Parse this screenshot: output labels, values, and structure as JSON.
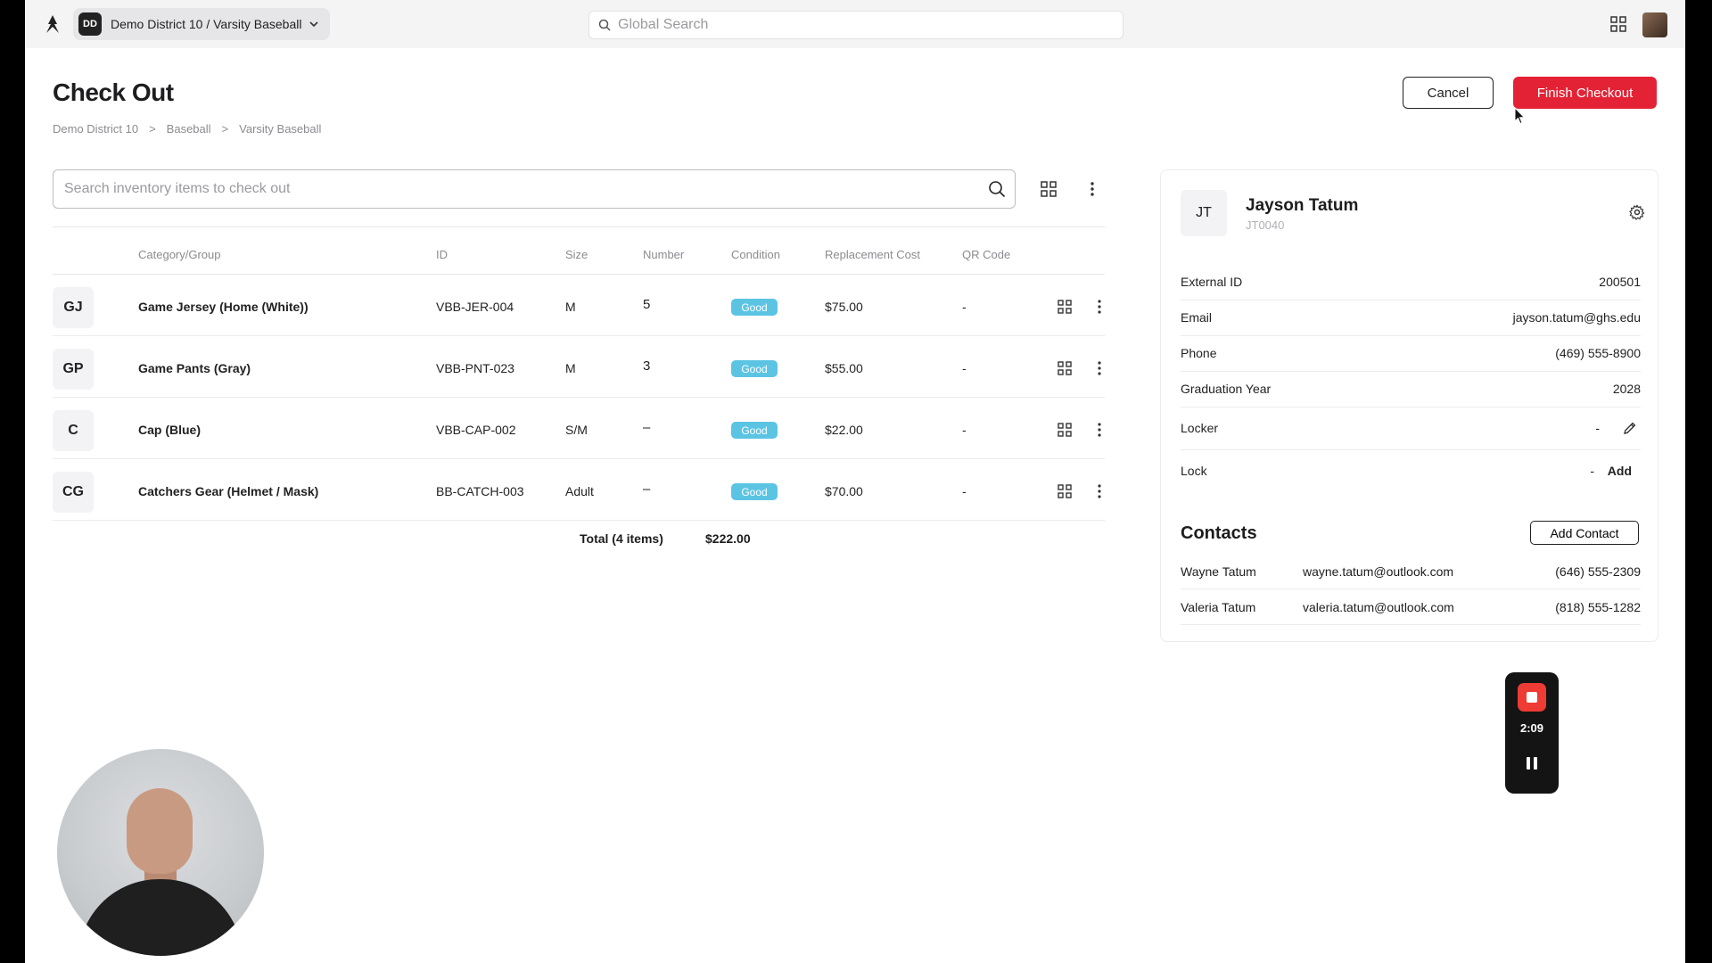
{
  "topbar": {
    "workspace_badge": "DD",
    "workspace_label": "Demo District 10 / Varsity Baseball",
    "search_placeholder": "Global Search"
  },
  "header": {
    "title": "Check Out",
    "breadcrumb": [
      "Demo District 10",
      "Baseball",
      "Varsity Baseball"
    ],
    "breadcrumb_sep": ">",
    "cancel_label": "Cancel",
    "finish_label": "Finish Checkout"
  },
  "inventory": {
    "search_placeholder": "Search inventory items to check out",
    "columns": [
      "Category/Group",
      "ID",
      "Size",
      "Number",
      "Condition",
      "Replacement Cost",
      "QR Code"
    ],
    "rows": [
      {
        "initials": "GJ",
        "name": "Game Jersey (Home (White))",
        "id": "VBB-JER-004",
        "size": "M",
        "number": "5",
        "condition": "Good",
        "cost": "$75.00",
        "qr": "-"
      },
      {
        "initials": "GP",
        "name": "Game Pants (Gray)",
        "id": "VBB-PNT-023",
        "size": "M",
        "number": "3",
        "condition": "Good",
        "cost": "$55.00",
        "qr": "-"
      },
      {
        "initials": "C",
        "name": "Cap (Blue)",
        "id": "VBB-CAP-002",
        "size": "S/M",
        "number": "–",
        "condition": "Good",
        "cost": "$22.00",
        "qr": "-"
      },
      {
        "initials": "CG",
        "name": "Catchers Gear (Helmet / Mask)",
        "id": "BB-CATCH-003",
        "size": "Adult",
        "number": "–",
        "condition": "Good",
        "cost": "$70.00",
        "qr": "-"
      }
    ],
    "total_label": "Total (4 items)",
    "total_value": "$222.00"
  },
  "student": {
    "initials": "JT",
    "name": "Jayson Tatum",
    "student_id": "JT0040",
    "fields": [
      {
        "label": "External ID",
        "value": "200501"
      },
      {
        "label": "Email",
        "value": "jayson.tatum@ghs.edu"
      },
      {
        "label": "Phone",
        "value": "(469) 555-8900"
      },
      {
        "label": "Graduation Year",
        "value": "2028"
      },
      {
        "label": "Locker",
        "value": "-"
      },
      {
        "label": "Lock",
        "value": "-"
      }
    ],
    "lock_add_label": "Add",
    "contacts_title": "Contacts",
    "add_contact_label": "Add Contact",
    "contacts": [
      {
        "name": "Wayne Tatum",
        "email": "wayne.tatum@outlook.com",
        "phone": "(646) 555-2309"
      },
      {
        "name": "Valeria Tatum",
        "email": "valeria.tatum@outlook.com",
        "phone": "(818) 555-1282"
      }
    ]
  },
  "recorder": {
    "time": "2:09"
  },
  "colors": {
    "accent": "#e42235",
    "badge_good": "#5cc4e3"
  }
}
